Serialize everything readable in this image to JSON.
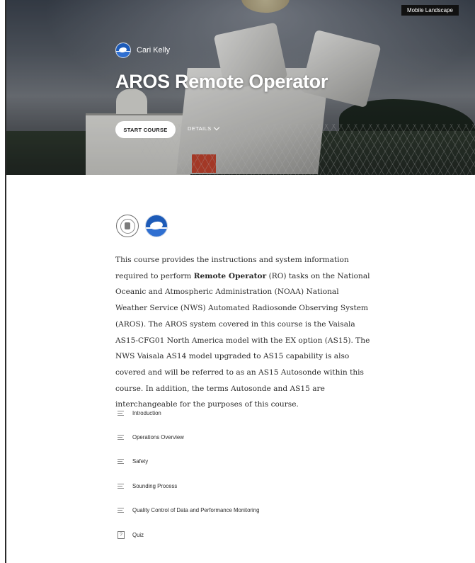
{
  "hero": {
    "badge": "Mobile Landscape",
    "author": "Cari Kelly",
    "title": "AROS Remote Operator",
    "start_label": "START COURSE",
    "details_label": "DETAILS"
  },
  "description": {
    "part1": "This course provides the instructions and system information required to perform ",
    "bold": "Remote Operator",
    "part2": " (RO) tasks on the National Oceanic and Atmospheric Administration (NOAA) National Weather Service (NWS) Automated Radiosonde Observing System (AROS). The AROS system covered in this course is the Vaisala AS15-CFG01 North America model with the EX option (AS15). The NWS Vaisala AS14 model upgraded to AS15 capability is also covered and will be referred to as an AS15 Autosonde within this course. In addition, the terms Autosonde and AS15 are interchangeable for the purposes of this course."
  },
  "lessons": [
    {
      "label": "Introduction",
      "icon": "lesson-lines-icon"
    },
    {
      "label": "Operations Overview",
      "icon": "lesson-lines-icon"
    },
    {
      "label": "Safety",
      "icon": "lesson-lines-icon"
    },
    {
      "label": "Sounding Process",
      "icon": "lesson-lines-icon"
    },
    {
      "label": "Quality Control of Data and Performance Monitoring",
      "icon": "lesson-lines-icon"
    },
    {
      "label": "Quiz",
      "icon": "quiz-icon"
    }
  ],
  "quiz_glyph": "?",
  "colors": {
    "badge_bg": "#111111",
    "noaa_blue": "#1d5bb8",
    "text": "#2a2a2a"
  }
}
